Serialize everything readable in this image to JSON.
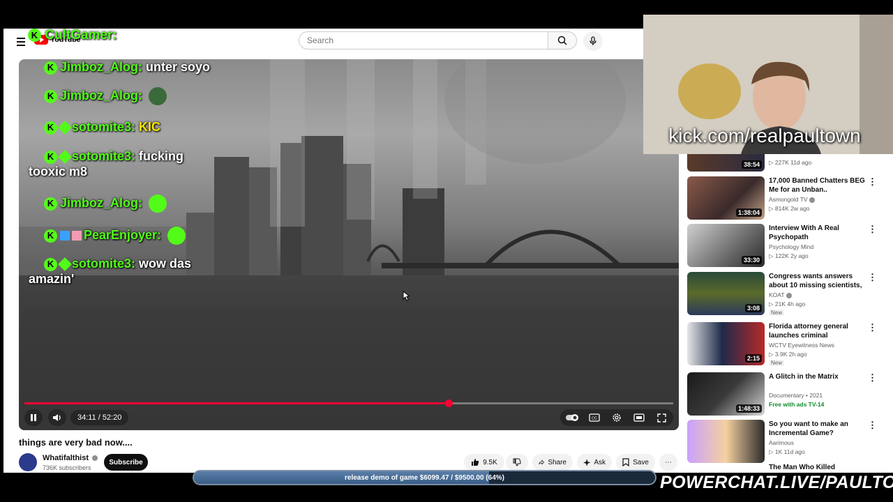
{
  "header": {
    "logo_text": "YouTube",
    "search_placeholder": "Search"
  },
  "player": {
    "current_time": "34:11",
    "duration": "52:20",
    "time_display": "34:11 / 52:20",
    "progress_fraction": 0.6533
  },
  "chat": {
    "messages": [
      {
        "user": "Jimboz_Alog:",
        "text": "unter soyo",
        "cont": ""
      },
      {
        "user": "Jimboz_Alog:",
        "text": "",
        "cont": ""
      },
      {
        "user": "sotomite3:",
        "text": "KIC",
        "cont": ""
      },
      {
        "user": "sotomite3:",
        "text": "fucking",
        "cont": "tooxic m8"
      },
      {
        "user": "Jimboz_Alog:",
        "text": "",
        "cont": ""
      },
      {
        "user": "PearEnjoyer:",
        "text": "",
        "cont": ""
      },
      {
        "user": "sotomite3:",
        "text": "wow das",
        "cont": "amazin'"
      }
    ],
    "top_user": "CultGamer:"
  },
  "video": {
    "title": "things are very bad now....",
    "channel": "Whatifalthist",
    "subscribers": "736K subscribers",
    "subscribe_label": "Subscribe",
    "likes": "9.5K",
    "share_label": "Share",
    "ask_label": "Ask",
    "save_label": "Save"
  },
  "recommendations": [
    {
      "title": "",
      "channel": "",
      "meta": "▷ 227K  11d ago",
      "duration": "38:54",
      "badge": ""
    },
    {
      "title": "17,000 Banned Chatters BEG Me for an Unban..",
      "channel": "Asmongold TV",
      "meta": "▷ 814K  2w ago",
      "duration": "1:38:04",
      "badge": ""
    },
    {
      "title": "Interview With A Real Psychopath",
      "channel": "Psychology Mind",
      "meta": "▷ 122K  2y ago",
      "duration": "33:30",
      "badge": ""
    },
    {
      "title": "Congress wants answers about 10 missing scientists, several ...",
      "channel": "KOAT",
      "meta": "▷ 21K  4h ago",
      "duration": "3:08",
      "badge": "New"
    },
    {
      "title": "Florida attorney general launches criminal investigatio...",
      "channel": "WCTV Eyewitness News",
      "meta": "▷ 3.9K  2h ago",
      "duration": "2:15",
      "badge": "New"
    },
    {
      "title": "A Glitch in the Matrix",
      "channel": "Documentary • 2021",
      "meta": "Free with ads   TV-14",
      "duration": "1:48:33",
      "badge": ""
    },
    {
      "title": "So you want to make an Incremental Game?",
      "channel": "Aarimous",
      "meta": "▷ 1K  11d ago",
      "duration": "",
      "badge": ""
    },
    {
      "title": "The Man Who Killed Hardcore",
      "channel": "",
      "meta": "",
      "duration": "",
      "badge": ""
    }
  ],
  "overlays": {
    "webcam_url": "kick.com/realpaultown",
    "goal_text": "release demo of game $6099.47 / $9500.00 (64%)",
    "goal_fraction": 0.64,
    "powerchat": "POWERCHAT.LIVE/PAULTOWN"
  },
  "colors": {
    "kick_green": "#53fc18",
    "yt_red": "#ff0000",
    "progress_red": "#ff0033"
  }
}
